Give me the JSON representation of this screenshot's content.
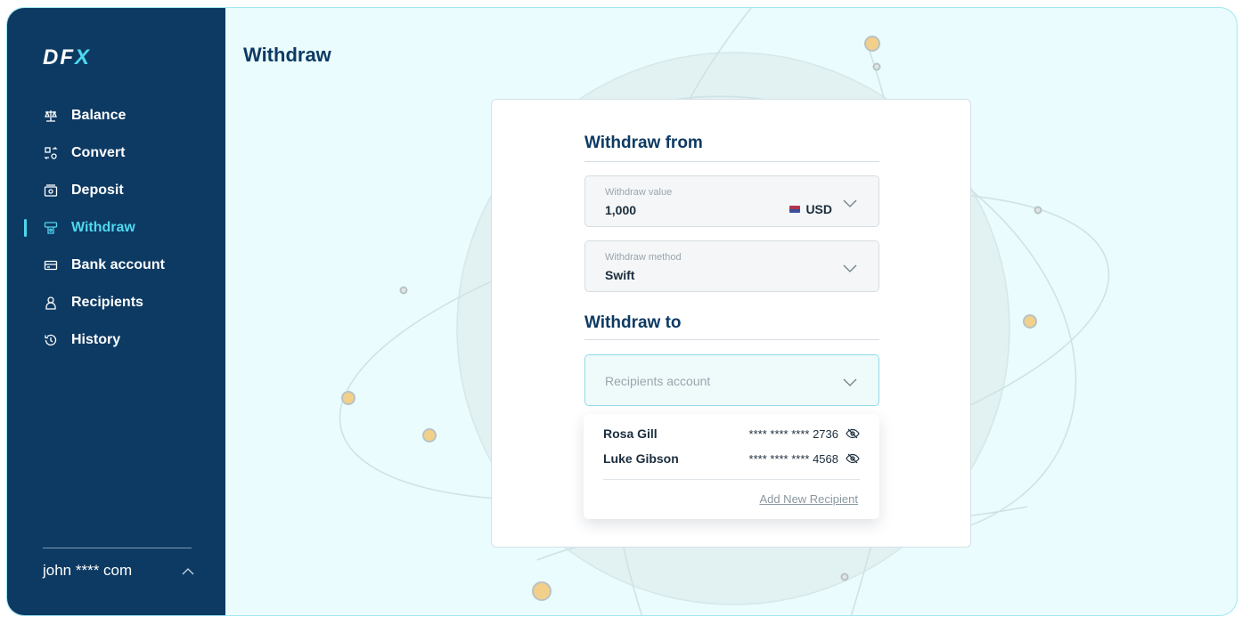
{
  "sidebar": {
    "logo": {
      "d": "DF",
      "x": "X"
    },
    "items": [
      {
        "label": "Balance",
        "icon": "scale-icon"
      },
      {
        "label": "Convert",
        "icon": "convert-icon"
      },
      {
        "label": "Deposit",
        "icon": "deposit-icon"
      },
      {
        "label": "Withdraw",
        "icon": "withdraw-icon",
        "active": true
      },
      {
        "label": "Bank account",
        "icon": "bank-card-icon"
      },
      {
        "label": "Recipients",
        "icon": "person-icon"
      },
      {
        "label": "History",
        "icon": "history-icon"
      }
    ],
    "account_label": "john **** com"
  },
  "main": {
    "title": "Withdraw",
    "withdraw_from": {
      "title": "Withdraw from",
      "value_field": {
        "label": "Withdraw value",
        "value": "1,000",
        "currency": "USD"
      },
      "method_field": {
        "label": "Withdraw method",
        "value": "Swift"
      }
    },
    "withdraw_to": {
      "title": "Withdraw to",
      "placeholder": "Recipients account",
      "recipients": [
        {
          "name": "Rosa Gill",
          "account": "**** **** **** 2736"
        },
        {
          "name": "Luke Gibson",
          "account": "**** **** **** 4568"
        }
      ],
      "add_label": "Add New Recipient"
    }
  },
  "colors": {
    "sidebar_bg": "#0d3a63",
    "accent": "#4fd8ee",
    "page_bg": "#eafcfd",
    "text_dark": "#0d3a63"
  }
}
